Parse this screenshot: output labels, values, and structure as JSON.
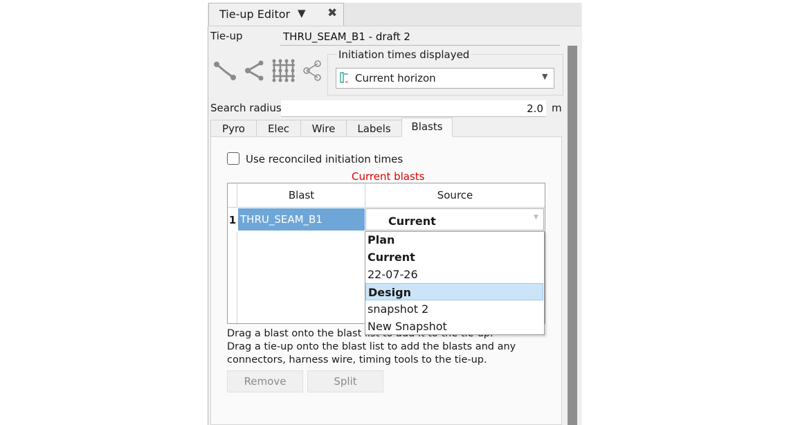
{
  "window": {
    "tab_title": "Tie-up Editor",
    "tab_menu_glyph": "▼",
    "tab_close_glyph": "✖"
  },
  "tieup": {
    "label": "Tie-up",
    "value": "THRU_SEAM_B1 - draft 2"
  },
  "toolbar_icons": [
    "connect-nodes-icon",
    "fan-out-icon",
    "grid-connect-icon",
    "share-icon"
  ],
  "initiation": {
    "group_title": "Initiation times displayed",
    "selected": "Current horizon",
    "icon": "horizon-icon"
  },
  "search_radius": {
    "label": "Search radius",
    "value": "2.0",
    "unit": "m"
  },
  "tabs": [
    {
      "label": "Pyro",
      "active": false
    },
    {
      "label": "Elec",
      "active": false
    },
    {
      "label": "Wire",
      "active": false
    },
    {
      "label": "Labels",
      "active": false
    },
    {
      "label": "Blasts",
      "active": true
    }
  ],
  "blasts_tab": {
    "use_reconciled_label": "Use reconciled initiation times",
    "use_reconciled_checked": false,
    "table_caption": "Current blasts",
    "caption_color": "#e00000",
    "columns": [
      "Blast",
      "Source"
    ],
    "rows": [
      {
        "index": "1",
        "blast": "THRU_SEAM_B1",
        "source": "Current"
      }
    ],
    "source_options": [
      {
        "label": "Plan",
        "bold": true,
        "highlighted": false
      },
      {
        "label": "Current",
        "bold": true,
        "highlighted": false
      },
      {
        "label": "22-07-26",
        "bold": false,
        "highlighted": false
      },
      {
        "label": "Design",
        "bold": true,
        "highlighted": true
      },
      {
        "label": "snapshot 2",
        "bold": false,
        "highlighted": false
      },
      {
        "label": "New Snapshot",
        "bold": false,
        "highlighted": false
      }
    ],
    "help_lines": [
      "Drag a blast onto the blast list to add it to the tie-up.",
      "Drag a tie-up onto the blast list to add the blasts and any",
      "connectors, harness wire, timing tools to the tie-up."
    ],
    "buttons": {
      "remove": "Remove",
      "split": "Split"
    }
  },
  "colors": {
    "selection": "#6ea6d8",
    "highlight": "#cce4f7"
  }
}
